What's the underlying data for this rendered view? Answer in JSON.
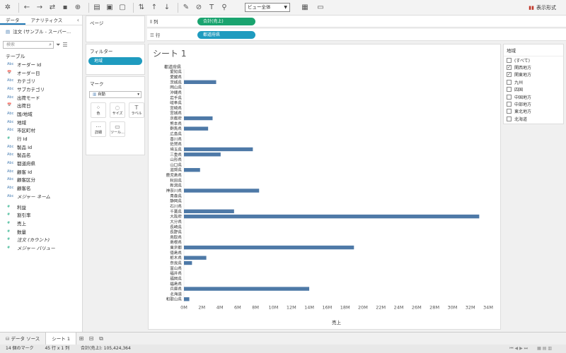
{
  "toolbar": {
    "view_select": "ビュー全体",
    "show_me": "表示形式"
  },
  "left_pane": {
    "tabs": [
      "データ",
      "アナリティクス"
    ],
    "data_source": "注文 (サンプル - スーパー...",
    "search_placeholder": "検索",
    "section": "テーブル",
    "fields": [
      {
        "type": "Abc",
        "name": "オーダー Id",
        "measure": false
      },
      {
        "type": "📅",
        "name": "オーダー日",
        "measure": false
      },
      {
        "type": "Abc",
        "name": "カテゴリ",
        "measure": false
      },
      {
        "type": "Abc",
        "name": "サブカテゴリ",
        "measure": false
      },
      {
        "type": "Abc",
        "name": "出荷モード",
        "measure": false
      },
      {
        "type": "📅",
        "name": "出荷日",
        "measure": false
      },
      {
        "type": "Abc",
        "name": "国/地域",
        "measure": false
      },
      {
        "type": "Abc",
        "name": "地域",
        "measure": false
      },
      {
        "type": "Abc",
        "name": "市区町村",
        "measure": false
      },
      {
        "type": "#",
        "name": "行 Id",
        "measure": true
      },
      {
        "type": "Abc",
        "name": "製品 Id",
        "measure": false
      },
      {
        "type": "Abc",
        "name": "製品名",
        "measure": false
      },
      {
        "type": "Abc",
        "name": "都道府県",
        "measure": false
      },
      {
        "type": "Abc",
        "name": "顧客 Id",
        "measure": false
      },
      {
        "type": "Abc",
        "name": "顧客区分",
        "measure": false
      },
      {
        "type": "Abc",
        "name": "顧客名",
        "measure": false
      },
      {
        "type": "Abc",
        "name": "メジャー ネーム",
        "measure": false,
        "italic": true
      },
      {
        "type": "#",
        "name": "利益",
        "measure": true
      },
      {
        "type": "#",
        "name": "割引率",
        "measure": true
      },
      {
        "type": "#",
        "name": "売上",
        "measure": true
      },
      {
        "type": "#",
        "name": "数量",
        "measure": true
      },
      {
        "type": "#",
        "name": "注文 (カウント)",
        "measure": true,
        "italic": true
      },
      {
        "type": "#",
        "name": "メジャー バリュー",
        "measure": true,
        "italic": true
      }
    ]
  },
  "mid_pane": {
    "pages_title": "ページ",
    "filters_title": "フィルター",
    "filter_pill": "地域",
    "marks_title": "マーク",
    "mark_type": "自動",
    "mark_buttons": [
      {
        "icon": "⁘",
        "label": "色"
      },
      {
        "icon": "◌",
        "label": "サイズ"
      },
      {
        "icon": "T",
        "label": "ラベル"
      },
      {
        "icon": "⋯",
        "label": "詳細"
      },
      {
        "icon": "▭",
        "label": "ツール..."
      }
    ]
  },
  "shelves": {
    "columns_label": "列",
    "columns_pill": "合計(売上)",
    "rows_label": "行",
    "rows_pill": "都道府県"
  },
  "sheet": {
    "title": "シート 1",
    "row_header": "都道府県"
  },
  "filter_card": {
    "title": "地域",
    "items": [
      {
        "label": "(すべて)",
        "checked": false
      },
      {
        "label": "関西地方",
        "checked": true
      },
      {
        "label": "関東地方",
        "checked": true
      },
      {
        "label": "九州",
        "checked": false
      },
      {
        "label": "四国",
        "checked": false
      },
      {
        "label": "中国地方",
        "checked": false
      },
      {
        "label": "中部地方",
        "checked": false
      },
      {
        "label": "東北地方",
        "checked": false
      },
      {
        "label": "北海道",
        "checked": false
      }
    ]
  },
  "bottom": {
    "datasource_tab": "データ ソース",
    "sheet_tab": "シート 1",
    "marks_count": "14 個のマーク",
    "rows_cols": "45 行 x 1 列",
    "total": "合計(売上): 105,424,364"
  },
  "chart_data": {
    "type": "bar",
    "orientation": "horizontal",
    "xlabel": "売上",
    "xlim": [
      0,
      34000000
    ],
    "xticks": [
      "0M",
      "2M",
      "4M",
      "6M",
      "8M",
      "10M",
      "12M",
      "14M",
      "16M",
      "18M",
      "20M",
      "22M",
      "24M",
      "26M",
      "28M",
      "30M",
      "32M",
      "34M"
    ],
    "bar_color": "#4e79a7",
    "categories": [
      "愛知県",
      "愛媛県",
      "茨城県",
      "岡山県",
      "沖縄県",
      "岩手県",
      "岐阜県",
      "宮崎県",
      "宮城県",
      "京都府",
      "熊本県",
      "群馬県",
      "広島県",
      "香川県",
      "佐賀県",
      "埼玉県",
      "三重県",
      "山形県",
      "山口県",
      "滋賀県",
      "鹿児島県",
      "秋田県",
      "新潟県",
      "神奈川県",
      "青森県",
      "静岡県",
      "石川県",
      "千葉県",
      "大阪府",
      "大分県",
      "長崎県",
      "長野県",
      "鳥取県",
      "島根県",
      "東京都",
      "徳島県",
      "栃木県",
      "奈良県",
      "富山県",
      "福井県",
      "福岡県",
      "福島県",
      "兵庫県",
      "北海道",
      "和歌山県"
    ],
    "values": [
      0,
      0,
      3600000,
      0,
      0,
      0,
      0,
      0,
      0,
      3200000,
      0,
      2700000,
      0,
      0,
      0,
      7700000,
      4100000,
      0,
      0,
      1800000,
      0,
      0,
      0,
      8400000,
      0,
      0,
      0,
      5600000,
      33000000,
      0,
      0,
      0,
      0,
      0,
      19000000,
      0,
      2500000,
      900000,
      0,
      0,
      0,
      0,
      14000000,
      0,
      600000
    ]
  }
}
